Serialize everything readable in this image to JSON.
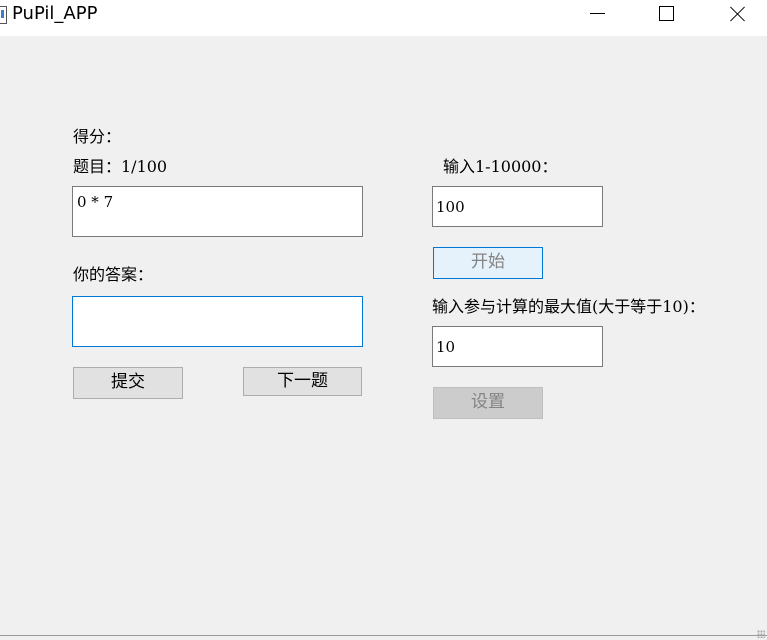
{
  "window": {
    "title": "PuPil_APP"
  },
  "left": {
    "score_label": "得分：",
    "question_label": "题目：1/100",
    "question_text": "0 * 7",
    "answer_label": "你的答案：",
    "answer_value": "",
    "submit_label": "提交",
    "next_label": "下一题"
  },
  "right": {
    "count_label": "输入1-10000：",
    "count_value": "100",
    "start_label": "开始",
    "max_label": "输入参与计算的最大值(大于等于10)：",
    "max_value": "10",
    "set_label": "设置"
  }
}
